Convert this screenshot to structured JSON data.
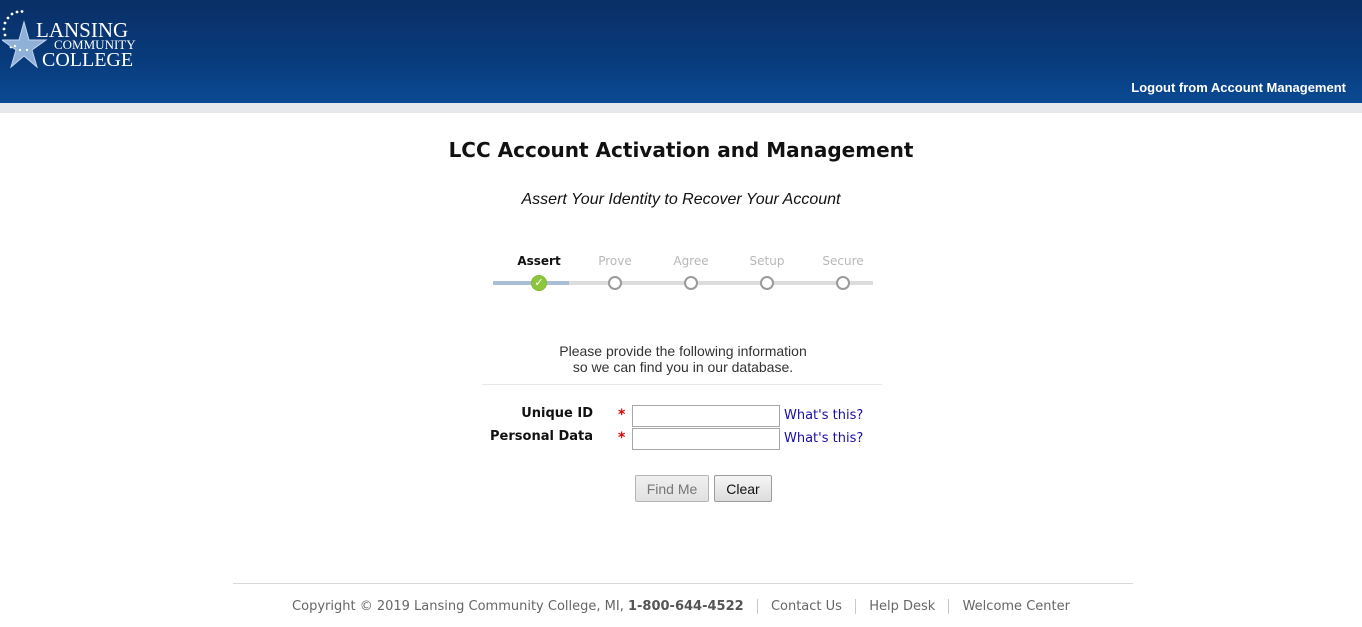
{
  "header": {
    "logo": {
      "line1": "LANSING",
      "line2": "COMMUNITY",
      "line3": "COLLEGE",
      "icon": "star-logo-icon"
    },
    "logout_label": "Logout from Account Management"
  },
  "page": {
    "title": "LCC Account Activation and Management",
    "subtitle": "Assert Your Identity to Recover Your Account"
  },
  "stepper": {
    "steps": [
      {
        "label": "Assert",
        "state": "done"
      },
      {
        "label": "Prove",
        "state": "pending"
      },
      {
        "label": "Agree",
        "state": "pending"
      },
      {
        "label": "Setup",
        "state": "pending"
      },
      {
        "label": "Secure",
        "state": "pending"
      }
    ],
    "check_glyph": "✓"
  },
  "instructions": {
    "line1": "Please provide the following information",
    "line2": "so we can find you in our database."
  },
  "form": {
    "fields": [
      {
        "label": "Unique ID",
        "required_mark": "*",
        "value": "",
        "help": "What's this?"
      },
      {
        "label": "Personal Data",
        "required_mark": "*",
        "value": "",
        "help": "What's this?"
      }
    ],
    "find_me_label": "Find Me",
    "clear_label": "Clear"
  },
  "footer": {
    "copyright": "Copyright © 2019 Lansing Community College, MI,",
    "phone": "1-800-644-4522",
    "links": [
      "Contact Us",
      "Help Desk",
      "Welcome Center"
    ]
  },
  "colors": {
    "header_top": "#0a2f66",
    "header_bottom": "#0a4a93",
    "step_done": "#8cc63f",
    "link": "#1a0dab",
    "required": "#e00000"
  }
}
